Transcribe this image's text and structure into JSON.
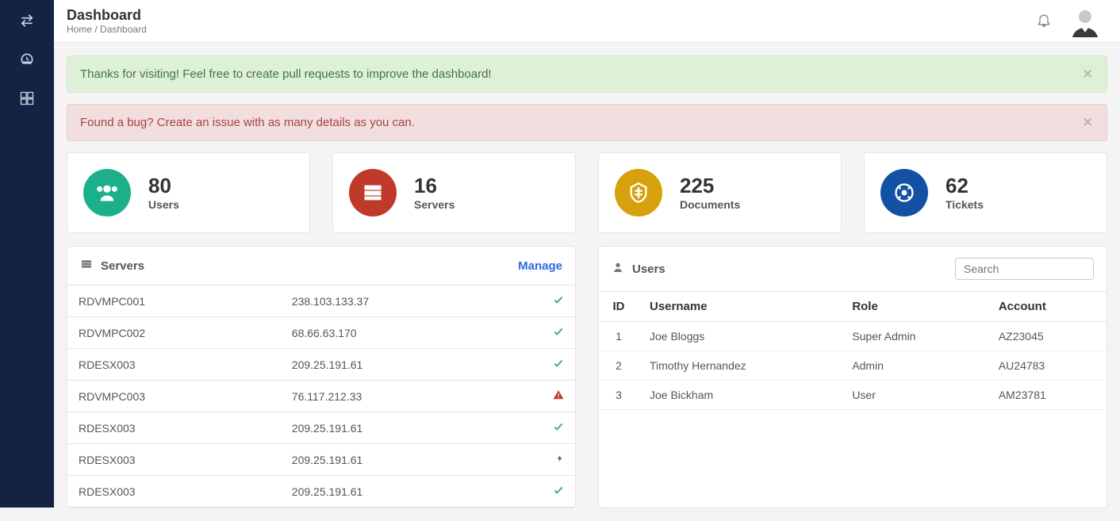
{
  "header": {
    "title": "Dashboard",
    "breadcrumb_home": "Home",
    "breadcrumb_sep": " / ",
    "breadcrumb_current": "Dashboard"
  },
  "alerts": {
    "success": "Thanks for visiting! Feel free to create pull requests to improve the dashboard!",
    "danger": "Found a bug? Create an issue with as many details as you can."
  },
  "stats": {
    "users": {
      "value": "80",
      "label": "Users"
    },
    "servers": {
      "value": "16",
      "label": "Servers"
    },
    "documents": {
      "value": "225",
      "label": "Documents"
    },
    "tickets": {
      "value": "62",
      "label": "Tickets"
    }
  },
  "servers_panel": {
    "title": "Servers",
    "manage": "Manage",
    "rows": [
      {
        "name": "RDVMPC001",
        "ip": "238.103.133.37",
        "status": "ok"
      },
      {
        "name": "RDVMPC002",
        "ip": "68.66.63.170",
        "status": "ok"
      },
      {
        "name": "RDESX003",
        "ip": "209.25.191.61",
        "status": "ok"
      },
      {
        "name": "RDVMPC003",
        "ip": "76.117.212.33",
        "status": "warn"
      },
      {
        "name": "RDESX003",
        "ip": "209.25.191.61",
        "status": "ok"
      },
      {
        "name": "RDESX003",
        "ip": "209.25.191.61",
        "status": "bolt"
      },
      {
        "name": "RDESX003",
        "ip": "209.25.191.61",
        "status": "ok"
      }
    ]
  },
  "users_panel": {
    "title": "Users",
    "search_placeholder": "Search",
    "columns": {
      "id": "ID",
      "username": "Username",
      "role": "Role",
      "account": "Account"
    },
    "rows": [
      {
        "id": "1",
        "username": "Joe Bloggs",
        "role": "Super Admin",
        "account": "AZ23045"
      },
      {
        "id": "2",
        "username": "Timothy Hernandez",
        "role": "Admin",
        "account": "AU24783"
      },
      {
        "id": "3",
        "username": "Joe Bickham",
        "role": "User",
        "account": "AM23781"
      }
    ]
  }
}
